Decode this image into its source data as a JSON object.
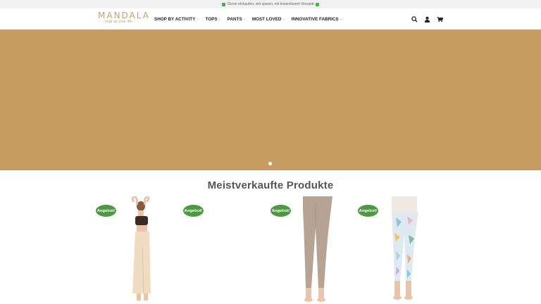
{
  "topbar": {
    "text": "Clever einkaufen, viel sparen, mit kostenlosem Versand"
  },
  "header": {
    "logo_brand": "MANDALA",
    "logo_tag": "yogi up your life",
    "nav": [
      {
        "label": "SHOP BY ACTIVITY"
      },
      {
        "label": "TOPS"
      },
      {
        "label": "PANTS"
      },
      {
        "label": "MOST LOVED"
      },
      {
        "label": "INNOVATIVE FABRICS"
      }
    ],
    "icons": [
      "search-icon",
      "account-icon",
      "cart-icon"
    ]
  },
  "hero": {
    "background": "#c69c62",
    "slide_count": 1
  },
  "products": {
    "title": "Meistverkaufte Produkte",
    "items": [
      {
        "badge": "Angebot!"
      },
      {
        "badge": "Angebot!"
      },
      {
        "badge": "Angebot!"
      },
      {
        "badge": "Angebot!"
      }
    ]
  },
  "colors": {
    "accent": "#c9a06a",
    "badge": "#4a9a3e",
    "hero": "#c69c62"
  }
}
